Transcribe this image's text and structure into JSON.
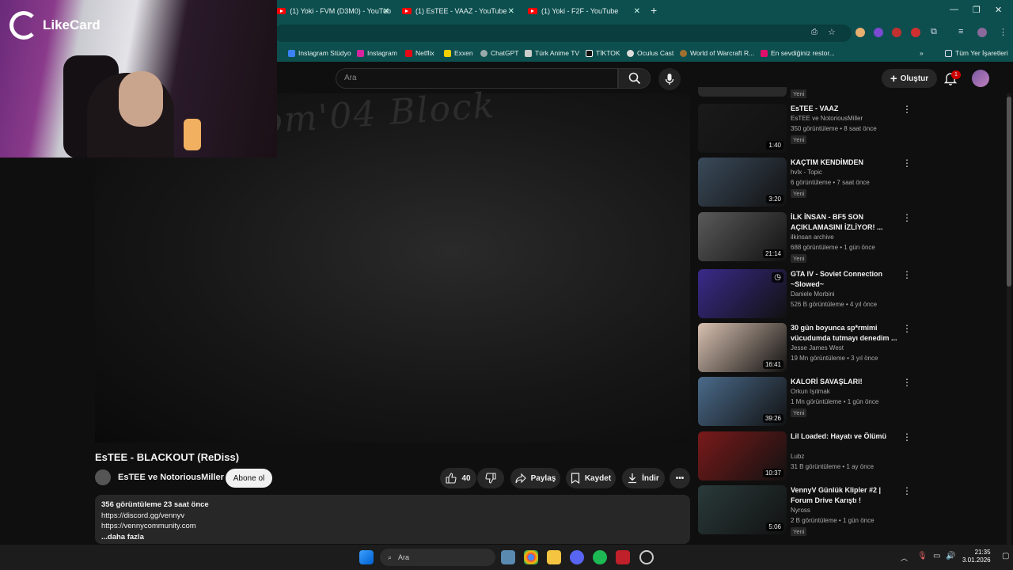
{
  "browser": {
    "tabs": [
      {
        "title": "(1) Yoki - FVM (D3M0) - YouTub"
      },
      {
        "title": "(1) EsTEE - VAAZ - YouTube"
      },
      {
        "title": "(1) Yoki - F2F - YouTube"
      }
    ],
    "bookmarks": [
      {
        "label": "Instagram Stüdyo",
        "icon": "meta-icon"
      },
      {
        "label": "Instagram",
        "icon": "instagram-icon"
      },
      {
        "label": "Netflix",
        "icon": "netflix-icon"
      },
      {
        "label": "Exxen",
        "icon": "exxen-icon"
      },
      {
        "label": "ChatGPT",
        "icon": "chatgpt-icon"
      },
      {
        "label": "Türk Anime TV",
        "icon": "anime-icon"
      },
      {
        "label": "TİKTOK",
        "icon": "tiktok-icon"
      },
      {
        "label": "Oculus Cast",
        "icon": "oculus-icon"
      },
      {
        "label": "World of Warcraft R...",
        "icon": "wow-icon"
      },
      {
        "label": "En sevdiğiniz restor...",
        "icon": "yemeksepeti-icon"
      }
    ],
    "all_bookmarks": "Tüm Yer İşaretleri"
  },
  "overlay": {
    "brand": "LikeCard"
  },
  "youtube": {
    "search_placeholder": "Ara",
    "create_label": "Oluştur",
    "notification_count": "1",
    "video": {
      "watermark": "om'04 Block",
      "title": "EsTEE - BLACKOUT (ReDiss)",
      "channel": "EsTEE ve NotoriousMiller",
      "subscribe": "Abone ol",
      "likes": "40",
      "share": "Paylaş",
      "save": "Kaydet",
      "download": "İndir",
      "desc_stats": "356 görüntüleme  23 saat önce",
      "desc_line1": "https://discord.gg/vennyv",
      "desc_line2": "https://vennycommunity.com",
      "more": "...daha fazla"
    },
    "recommendations": [
      {
        "title": "EsTEE - VAAZ",
        "channel": "EsTEE ve NotoriousMiller",
        "meta": "350 görüntüleme • 8 saat önce",
        "badge": "Yeni",
        "duration": "1:40",
        "color": "#1a1a1a"
      },
      {
        "title": "KAÇTIM KENDİMDEN",
        "channel": "hvlx - Topic",
        "meta": "6 görüntüleme • 7 saat önce",
        "badge": "Yeni",
        "duration": "3:20",
        "color": "#3a4a5a"
      },
      {
        "title": "İLK İNSAN - BF5 SON AÇIKLAMASINI İZLİYOR! ...",
        "channel": "ilkinsan archive",
        "meta": "688 görüntüleme • 1 gün önce",
        "badge": "Yeni",
        "duration": "21:14",
        "color": "#5a5a5a"
      },
      {
        "title": "GTA IV - Soviet Connection ~Slowed~",
        "channel": "Daniele Morbini",
        "meta": "526 B görüntüleme • 4 yıl önce",
        "badge": "",
        "duration": "",
        "color": "#3a2a8a"
      },
      {
        "title": "30 gün boyunca sp*rmimi vücudumda tutmayı denedim ...",
        "channel": "Jesse James West",
        "meta": "19 Mn görüntüleme • 3 yıl önce",
        "badge": "",
        "duration": "16:41",
        "color": "#d8c0b0"
      },
      {
        "title": "KALORİ SAVAŞLARI!",
        "channel": "Orkun Işıtmak",
        "meta": "1 Mn görüntüleme • 1 gün önce",
        "badge": "Yeni",
        "duration": "39:26",
        "color": "#4a6a8a"
      },
      {
        "title": "Lil Loaded: Hayatı ve Ölümü",
        "channel": "Lubz",
        "meta": "31 B görüntüleme • 1 ay önce",
        "badge": "",
        "duration": "10:37",
        "color": "#7a1a1a"
      },
      {
        "title": "VennyV Günlük Klipler #2 | Forum Drive Karıştı !",
        "channel": "Nyross",
        "meta": "2 B görüntüleme • 1 gün önce",
        "badge": "Yeni",
        "duration": "5:06",
        "color": "#2a3a3a"
      }
    ]
  },
  "taskbar": {
    "search": "Ara",
    "time": "21:35",
    "date": "3.01.2026"
  }
}
